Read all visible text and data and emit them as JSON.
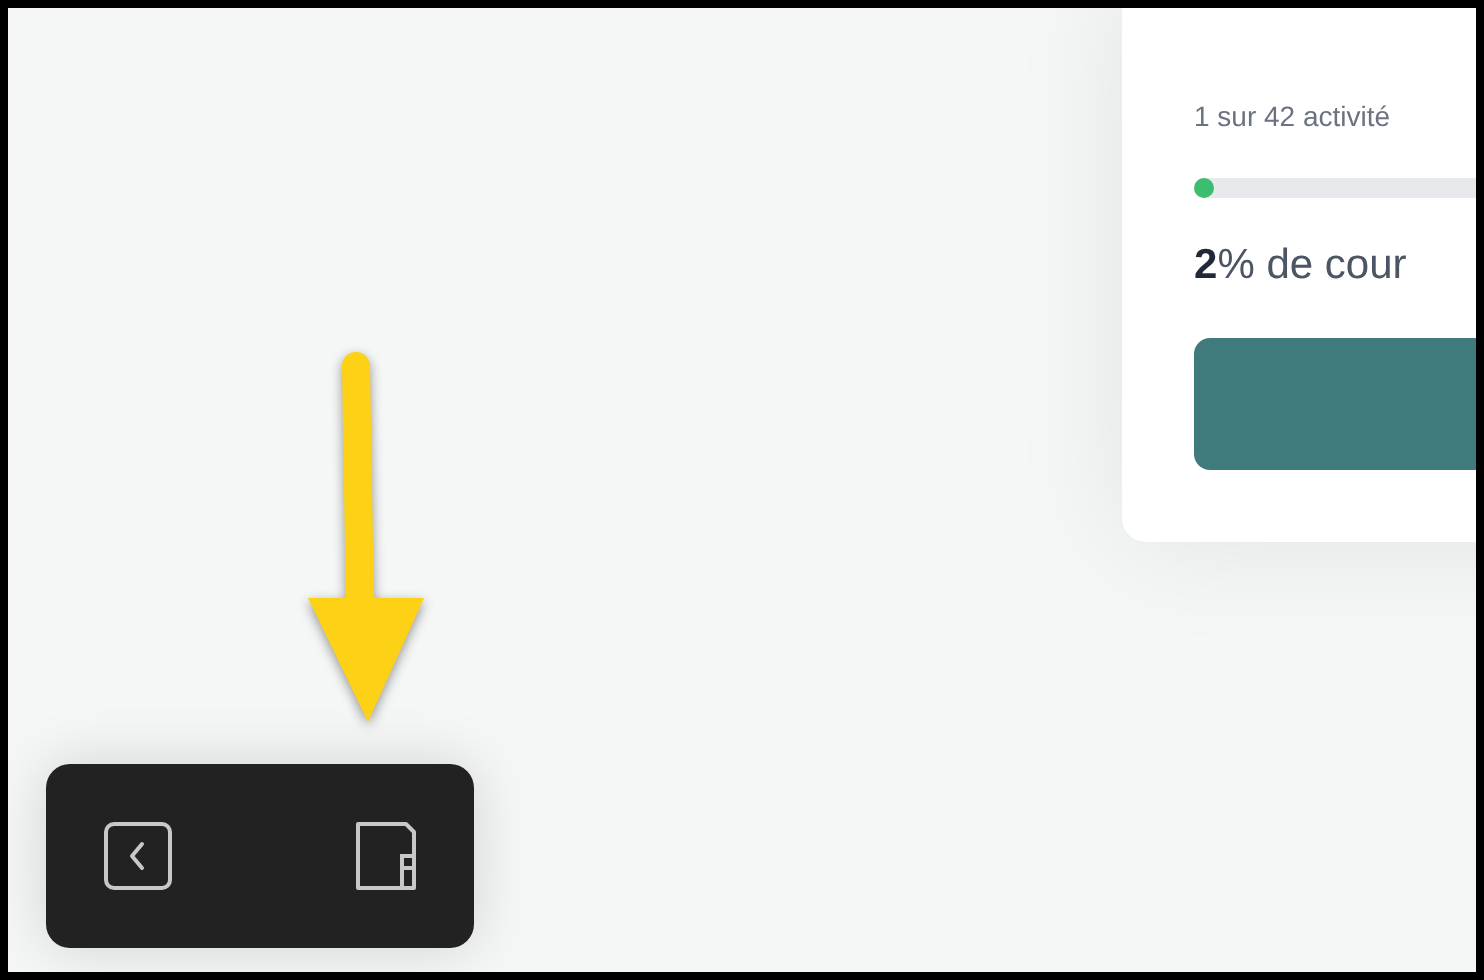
{
  "progress_card": {
    "activities": "1 sur 42 activité",
    "level": 0.02,
    "completion": "**2**% de cour"
  },
  "toolbar": [
    {
      "kind": "back"
    },
    {
      "kind": "book"
    }
  ]
}
